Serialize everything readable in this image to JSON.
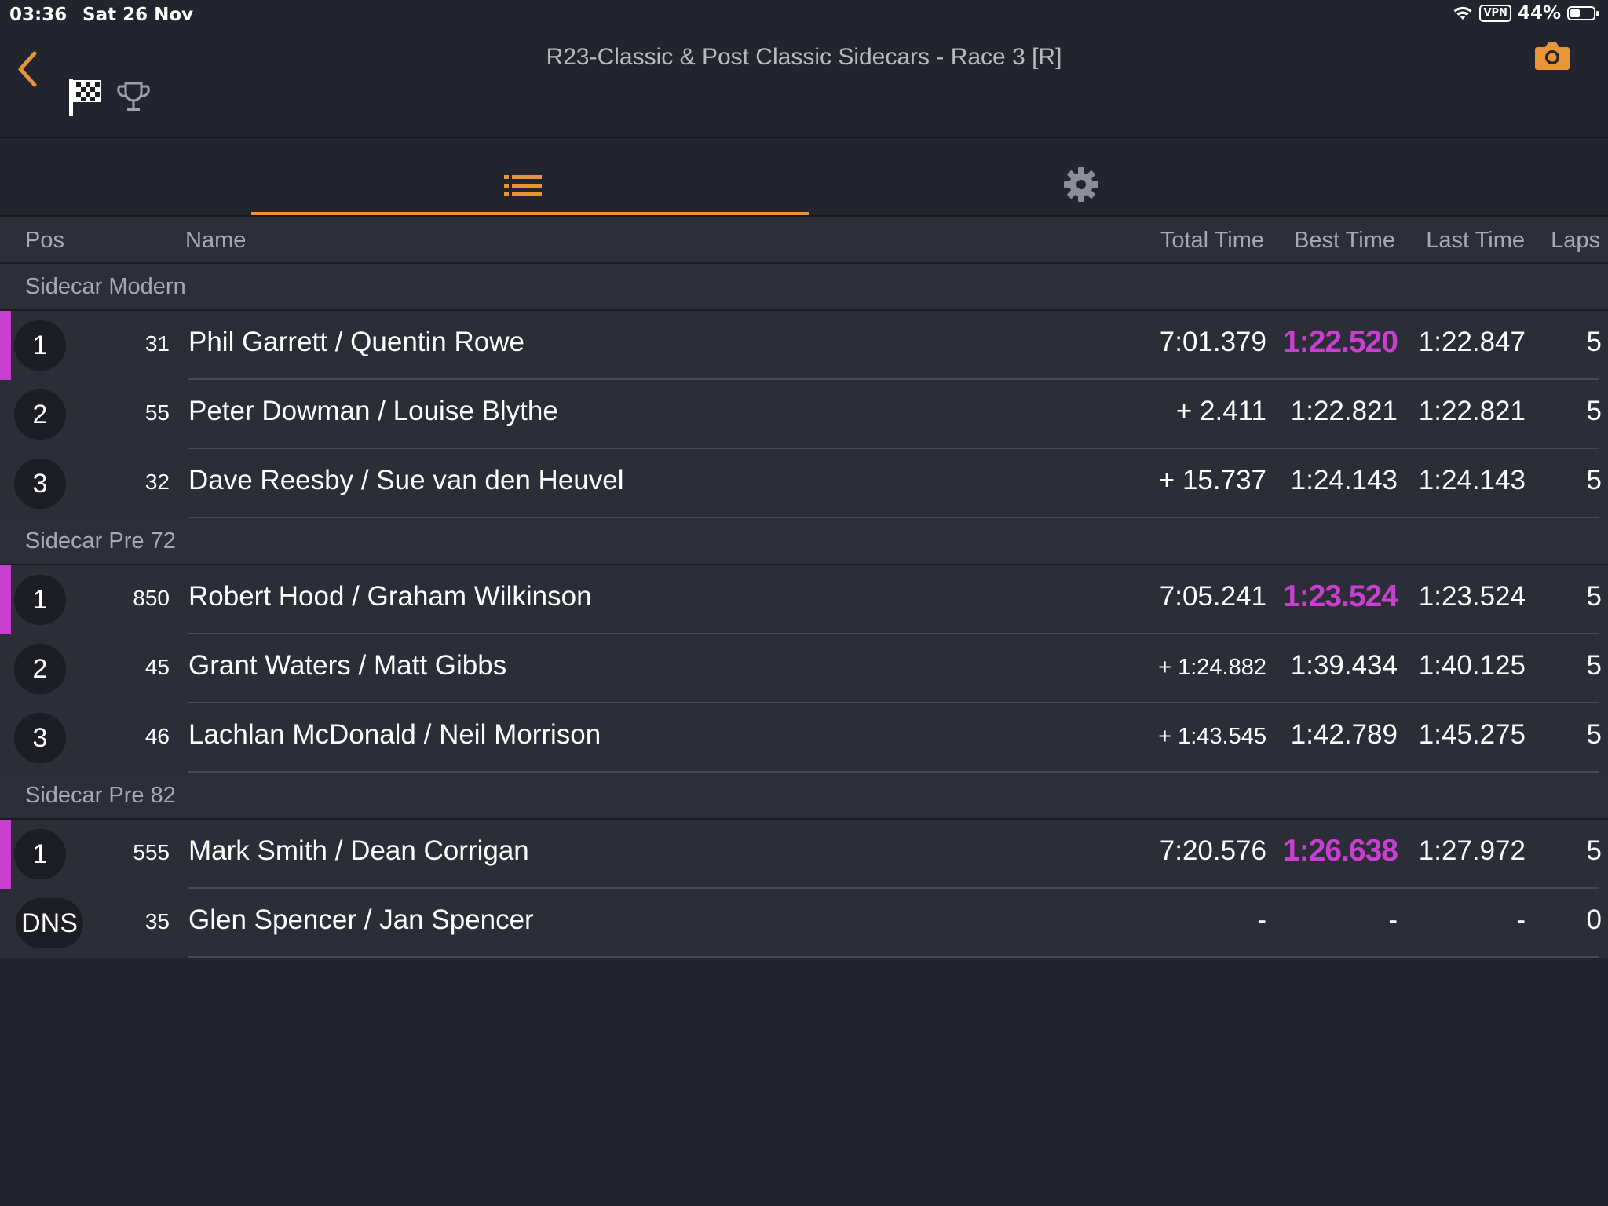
{
  "status_bar": {
    "time": "03:36",
    "date": "Sat 26 Nov",
    "vpn": "VPN",
    "battery": "44%",
    "battery_level": 0.44
  },
  "header": {
    "title": "R23-Classic & Post Classic Sidecars - Race 3 [R]"
  },
  "columns": {
    "pos": "Pos",
    "name": "Name",
    "total": "Total Time",
    "best": "Best Time",
    "last": "Last Time",
    "laps": "Laps"
  },
  "colors": {
    "accent": "#e8953a",
    "fastest": "#c93fd0",
    "background": "#22252d"
  },
  "groups": [
    {
      "name": "Sidecar Modern",
      "rows": [
        {
          "pos": "1",
          "number": "31",
          "name": "Phil Garrett / Quentin Rowe",
          "total": "7:01.379",
          "best": "1:22.520",
          "last": "1:22.847",
          "laps": "5",
          "leader": true,
          "fastest": true
        },
        {
          "pos": "2",
          "number": "55",
          "name": "Peter Dowman / Louise Blythe",
          "total": "+ 2.411",
          "best": "1:22.821",
          "last": "1:22.821",
          "laps": "5"
        },
        {
          "pos": "3",
          "number": "32",
          "name": "Dave Reesby / Sue van den Heuvel",
          "total": "+ 15.737",
          "best": "1:24.143",
          "last": "1:24.143",
          "laps": "5"
        }
      ]
    },
    {
      "name": "Sidecar Pre 72",
      "rows": [
        {
          "pos": "1",
          "number": "850",
          "name": "Robert Hood / Graham Wilkinson",
          "total": "7:05.241",
          "best": "1:23.524",
          "last": "1:23.524",
          "laps": "5",
          "leader": true,
          "fastest": true
        },
        {
          "pos": "2",
          "number": "45",
          "name": "Grant Waters / Matt Gibbs",
          "total": "+ 1:24.882",
          "best": "1:39.434",
          "last": "1:40.125",
          "laps": "5",
          "small_total": true
        },
        {
          "pos": "3",
          "number": "46",
          "name": "Lachlan McDonald / Neil Morrison",
          "total": "+ 1:43.545",
          "best": "1:42.789",
          "last": "1:45.275",
          "laps": "5",
          "small_total": true
        }
      ]
    },
    {
      "name": "Sidecar Pre 82",
      "rows": [
        {
          "pos": "1",
          "number": "555",
          "name": "Mark Smith / Dean Corrigan",
          "total": "7:20.576",
          "best": "1:26.638",
          "last": "1:27.972",
          "laps": "5",
          "leader": true,
          "fastest": true
        },
        {
          "pos": "DNS",
          "number": "35",
          "name": "Glen Spencer / Jan Spencer",
          "total": "-",
          "best": "-",
          "last": "-",
          "laps": "0"
        }
      ]
    }
  ]
}
